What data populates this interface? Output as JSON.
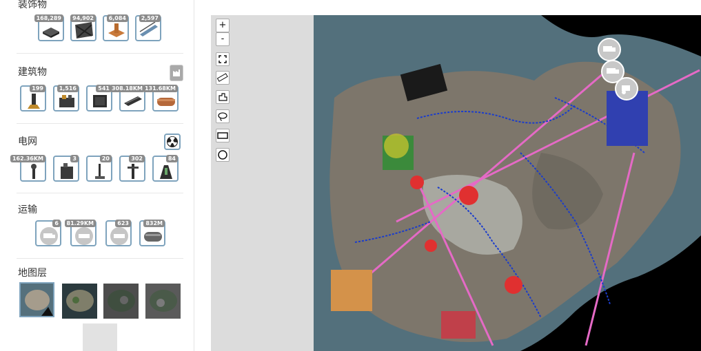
{
  "sidebar": {
    "decorations": {
      "title": "装饰物",
      "items": [
        {
          "icon": "foundation-icon",
          "count": "168,289"
        },
        {
          "icon": "wall-icon",
          "count": "94,902"
        },
        {
          "icon": "pillar-icon",
          "count": "6,084"
        },
        {
          "icon": "walkway-icon",
          "count": "2,597"
        }
      ]
    },
    "buildings": {
      "title": "建筑物",
      "items": [
        {
          "icon": "miner-icon",
          "count": "199"
        },
        {
          "icon": "assembler-icon",
          "count": "1,516"
        },
        {
          "icon": "storage-icon",
          "count": "541"
        },
        {
          "icon": "conveyor-belt-icon",
          "count": "308.18KM"
        },
        {
          "icon": "pipeline-icon",
          "count": "131.68KM"
        }
      ]
    },
    "power": {
      "title": "电网",
      "items": [
        {
          "icon": "power-line-icon",
          "count": "162.36KM"
        },
        {
          "icon": "generator-icon",
          "count": "3"
        },
        {
          "icon": "power-pole-icon",
          "count": "20"
        },
        {
          "icon": "power-tower-icon",
          "count": "302"
        },
        {
          "icon": "power-storage-icon",
          "count": "84"
        }
      ]
    },
    "transport": {
      "title": "运输",
      "items": [
        {
          "icon": "truck-icon",
          "count": "6"
        },
        {
          "icon": "railway-icon",
          "count": "81.29KM"
        },
        {
          "icon": "train-icon",
          "count": "623"
        },
        {
          "icon": "hypertube-icon",
          "count": "832M"
        }
      ]
    },
    "map_layers": {
      "title": "地图层",
      "items": [
        {
          "icon": "layer-default-icon"
        },
        {
          "icon": "layer-satellite-icon"
        },
        {
          "icon": "layer-dark-icon"
        },
        {
          "icon": "layer-terrain-icon"
        }
      ]
    }
  },
  "map_controls": [
    {
      "icon": "zoom-in-icon",
      "label": "+"
    },
    {
      "icon": "zoom-out-icon",
      "label": "-"
    },
    {
      "icon": "fullscreen-icon"
    },
    {
      "icon": "ruler-icon"
    },
    {
      "icon": "polygon-icon"
    },
    {
      "icon": "lasso-icon"
    },
    {
      "icon": "rectangle-icon"
    },
    {
      "icon": "circle-icon"
    }
  ],
  "colors": {
    "tile_border": "#7ea3bd",
    "water": "#4e6e7a",
    "land": "#7d766b",
    "conveyor": "#1a3ccc",
    "railway": "#e56ac6"
  }
}
